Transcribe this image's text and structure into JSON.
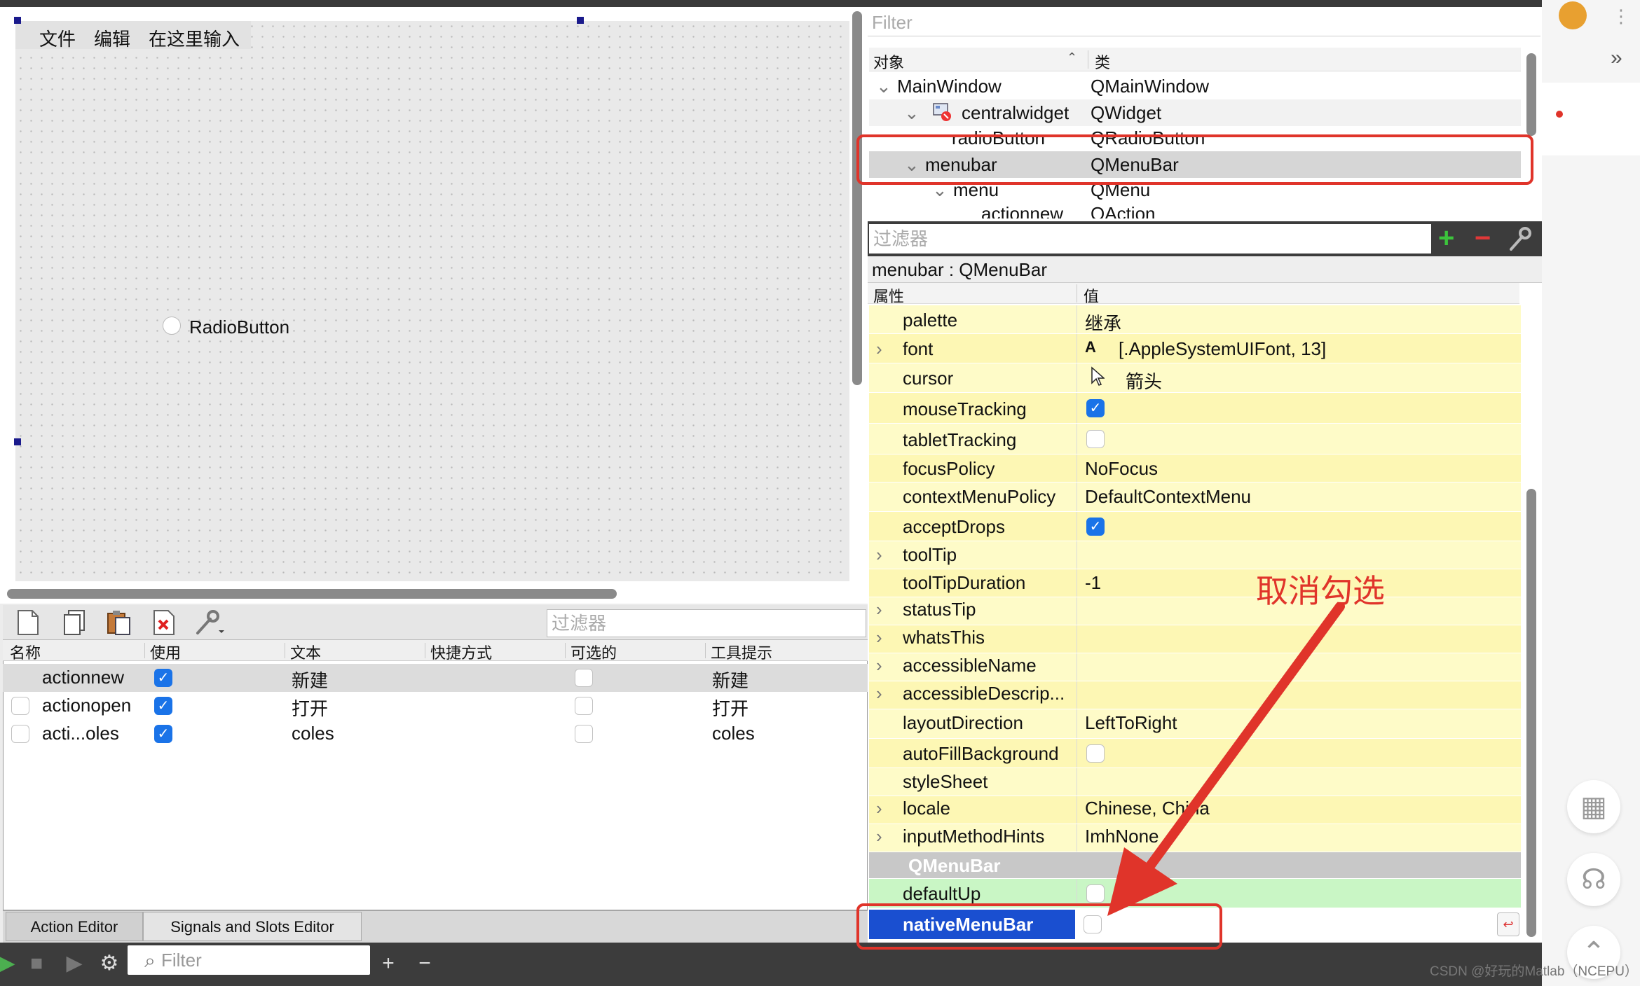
{
  "form": {
    "menus": [
      "文件",
      "编辑",
      "在这里输入"
    ],
    "radio_label": "RadioButton"
  },
  "action_editor": {
    "filter_placeholder": "过滤器",
    "columns": [
      "名称",
      "使用",
      "文本",
      "快捷方式",
      "可选的",
      "工具提示"
    ],
    "rows": [
      {
        "name": "actionnew",
        "used": true,
        "text": "新建",
        "shortcut": "",
        "checkable": false,
        "tooltip": "新建"
      },
      {
        "name": "actionopen",
        "used": true,
        "text": "打开",
        "shortcut": "",
        "checkable": false,
        "tooltip": "打开"
      },
      {
        "name": "acti...oles",
        "used": true,
        "text": "coles",
        "shortcut": "",
        "checkable": false,
        "tooltip": "coles"
      }
    ],
    "tabs": [
      "Action Editor",
      "Signals and Slots Editor"
    ]
  },
  "bottom_bar": {
    "filter_placeholder": "Filter"
  },
  "object_inspector": {
    "filter_placeholder": "Filter",
    "columns": [
      "对象",
      "类"
    ],
    "rows": [
      {
        "object": "MainWindow",
        "class": "QMainWindow"
      },
      {
        "object": "centralwidget",
        "class": "QWidget"
      },
      {
        "object": "radioButton",
        "class": "QRadioButton"
      },
      {
        "object": "menubar",
        "class": "QMenuBar"
      },
      {
        "object": "menu",
        "class": "QMenu"
      },
      {
        "object": "actionnew",
        "class": "QAction"
      }
    ]
  },
  "property_editor": {
    "filter_placeholder": "过滤器",
    "title": "menubar : QMenuBar",
    "columns": [
      "属性",
      "值"
    ],
    "rows": [
      {
        "name": "palette",
        "value": "继承"
      },
      {
        "name": "font",
        "value": "[.AppleSystemUIFont, 13]"
      },
      {
        "name": "cursor",
        "value": "箭头"
      },
      {
        "name": "mouseTracking",
        "value": ""
      },
      {
        "name": "tabletTracking",
        "value": ""
      },
      {
        "name": "focusPolicy",
        "value": "NoFocus"
      },
      {
        "name": "contextMenuPolicy",
        "value": "DefaultContextMenu"
      },
      {
        "name": "acceptDrops",
        "value": ""
      },
      {
        "name": "toolTip",
        "value": ""
      },
      {
        "name": "toolTipDuration",
        "value": "-1"
      },
      {
        "name": "statusTip",
        "value": ""
      },
      {
        "name": "whatsThis",
        "value": ""
      },
      {
        "name": "accessibleName",
        "value": ""
      },
      {
        "name": "accessibleDescrip...",
        "value": ""
      },
      {
        "name": "layoutDirection",
        "value": "LeftToRight"
      },
      {
        "name": "autoFillBackground",
        "value": ""
      },
      {
        "name": "styleSheet",
        "value": ""
      },
      {
        "name": "locale",
        "value": "Chinese, China"
      },
      {
        "name": "inputMethodHints",
        "value": "ImhNone"
      }
    ],
    "checkbox_states": {
      "mouseTracking": true,
      "tabletTracking": false,
      "acceptDrops": true,
      "autoFillBackground": false
    },
    "section": "QMenuBar",
    "section_rows": [
      {
        "name": "defaultUp",
        "value": ""
      },
      {
        "name": "nativeMenuBar",
        "value": ""
      }
    ]
  },
  "annotation": {
    "text": "取消勾选",
    "color": "#e0342a"
  },
  "side_icons": [
    "qr-code-icon",
    "headset-icon",
    "back-to-top-icon"
  ],
  "watermark": "CSDN @好玩的Matlab（NCEPU）"
}
